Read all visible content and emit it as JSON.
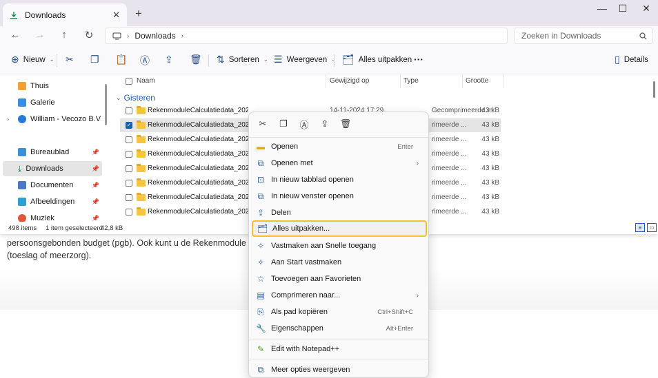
{
  "background": {
    "lines": [
      "persoonsgebonden budget (pgb). Ook kunt u de Rekenmodule g",
      "(toeslag of meerzorg)."
    ]
  },
  "window": {
    "tab_title": "Downloads",
    "address": {
      "location": "Downloads"
    },
    "search_placeholder": "Zoeken in Downloads",
    "toolbar": {
      "new_label": "Nieuw",
      "sort_label": "Sorteren",
      "view_label": "Weergeven",
      "extract_all_label": "Alles uitpakken",
      "more_label": "···",
      "details_label": "Details"
    },
    "sidebar": {
      "items": [
        {
          "label": "Thuis"
        },
        {
          "label": "Galerie"
        },
        {
          "label": "William - Vecozo B.V"
        },
        {
          "label": "Bureaublad"
        },
        {
          "label": "Downloads"
        },
        {
          "label": "Documenten"
        },
        {
          "label": "Afbeeldingen"
        },
        {
          "label": "Muziek"
        }
      ]
    },
    "columns": {
      "name": "Naam",
      "modified": "Gewijzigd op",
      "type": "Type",
      "size": "Grootte"
    },
    "group_label": "Gisteren",
    "rows": [
      {
        "name": "RekenmoduleCalculatiedata_20241114_172530",
        "date": "14-11-2024 17:29",
        "type": "Gecomprimeerde m",
        "size": "43 kB"
      },
      {
        "name": "RekenmoduleCalculatiedata_20241114",
        "date": "",
        "type": "rimeerde ...",
        "size": "43 kB"
      },
      {
        "name": "RekenmoduleCalculatiedata_20241114",
        "date": "",
        "type": "rimeerde ...",
        "size": "43 kB"
      },
      {
        "name": "RekenmoduleCalculatiedata_20241114",
        "date": "",
        "type": "rimeerde ...",
        "size": "43 kB"
      },
      {
        "name": "RekenmoduleCalculatiedata_20241114",
        "date": "",
        "type": "rimeerde ...",
        "size": "43 kB"
      },
      {
        "name": "RekenmoduleCalculatiedata_20241114",
        "date": "",
        "type": "rimeerde ...",
        "size": "43 kB"
      },
      {
        "name": "RekenmoduleCalculatiedata_20241114",
        "date": "",
        "type": "rimeerde ...",
        "size": "43 kB"
      },
      {
        "name": "RekenmoduleCalculatiedata_20241114",
        "date": "",
        "type": "rimeerde ...",
        "size": "43 kB"
      }
    ],
    "status": {
      "count": "498 items",
      "selection": "1 item geselecteerd",
      "size": "42,8 kB"
    }
  },
  "context_menu": {
    "items": [
      {
        "label": "Openen",
        "shortcut": "Enter"
      },
      {
        "label": "Openen met",
        "shortcut": ""
      },
      {
        "label": "In nieuw tabblad openen",
        "shortcut": ""
      },
      {
        "label": "In nieuw venster openen",
        "shortcut": ""
      },
      {
        "label": "Delen",
        "shortcut": ""
      },
      {
        "label": "Alles uitpakken...",
        "shortcut": ""
      },
      {
        "label": "Vastmaken aan Snelle toegang",
        "shortcut": ""
      },
      {
        "label": "Aan Start vastmaken",
        "shortcut": ""
      },
      {
        "label": "Toevoegen aan Favorieten",
        "shortcut": ""
      },
      {
        "label": "Comprimeren naar...",
        "shortcut": ""
      },
      {
        "label": "Als pad kopiëren",
        "shortcut": "Ctrl+Shift+C"
      },
      {
        "label": "Eigenschappen",
        "shortcut": "Alt+Enter"
      },
      {
        "label": "Edit with Notepad++",
        "shortcut": ""
      },
      {
        "label": "Meer opties weergeven",
        "shortcut": ""
      }
    ]
  },
  "colors": {
    "accent": "#1a5fb4",
    "highlight_border": "#f2c12e",
    "title_bar": "#e8e4ee"
  }
}
